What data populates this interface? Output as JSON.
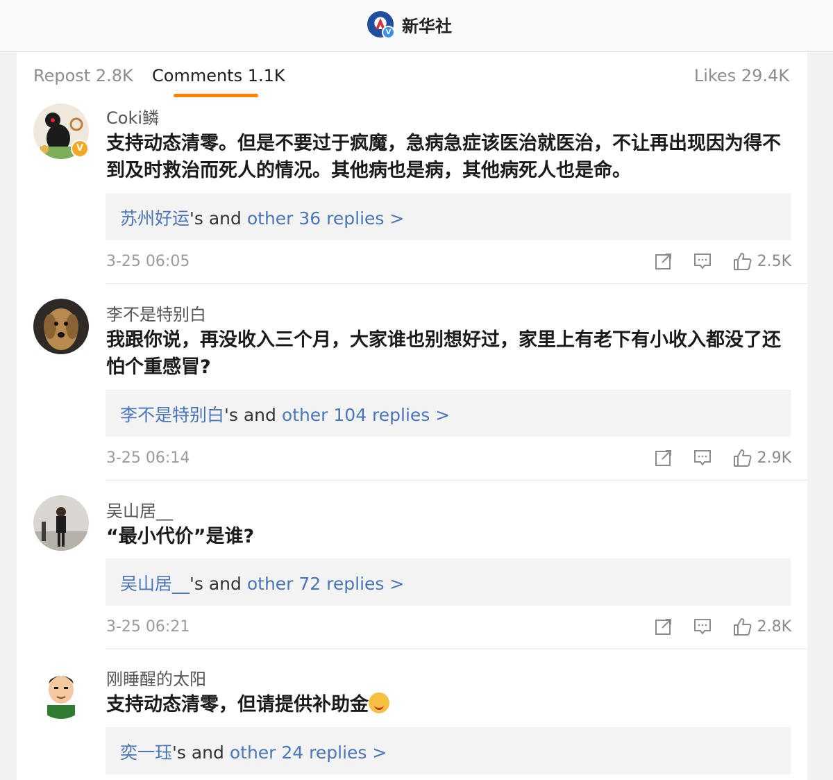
{
  "header": {
    "account_name": "新华社",
    "verified_mark": "V"
  },
  "tabs": {
    "repost": "Repost 2.8K",
    "comments": "Comments 1.1K",
    "likes": "Likes 29.4K"
  },
  "comments": [
    {
      "username": "Coki鳞",
      "text": "支持动态清零。但是不要过于疯魔，急病急症该医治就医治，不让再出现因为得不到及时救治而死人的情况。其他病也是病，其他病死人也是命。",
      "reply_user": "苏州好运",
      "reply_mid": "'s and ",
      "reply_more": "other 36 replies >",
      "time": "3-25 06:05",
      "likes": "2.5K",
      "badge": "V"
    },
    {
      "username": "李不是特别白",
      "text": "我跟你说，再没收入三个月，大家谁也别想好过，家里上有老下有小收入都没了还怕个重感冒?",
      "reply_user": "李不是特别白",
      "reply_mid": "'s and ",
      "reply_more": "other 104 replies >",
      "time": "3-25 06:14",
      "likes": "2.9K"
    },
    {
      "username": "吴山居__",
      "text": "“最小代价”是谁?",
      "reply_user": "吴山居__",
      "reply_mid": "'s and ",
      "reply_more": "other 72 replies >",
      "time": "3-25 06:21",
      "likes": "2.8K"
    },
    {
      "username": "刚睡醒的太阳",
      "text": "支持动态清零，但请提供补助金",
      "reply_user": "奕一珏",
      "reply_mid": "'s and ",
      "reply_more": "other 24 replies >"
    }
  ],
  "icons": {
    "share": "share-icon",
    "comment": "comment-icon",
    "like": "thumbs-up-icon"
  },
  "colors": {
    "accent": "#ff8200",
    "link": "#4a76b8",
    "verified_blue": "#3b8ff0",
    "verified_orange": "#f5a623"
  }
}
